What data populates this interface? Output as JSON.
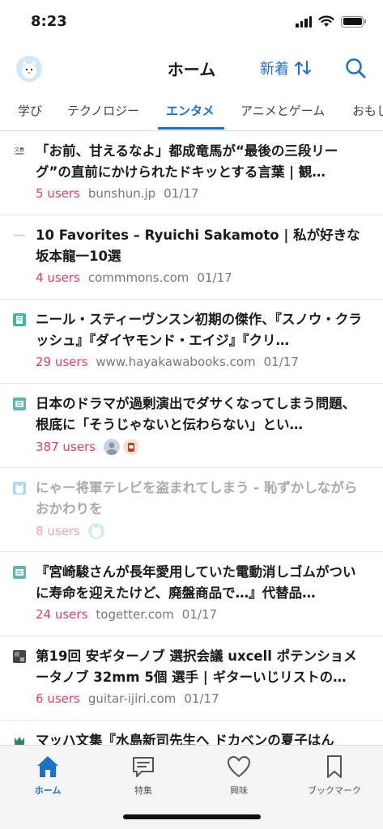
{
  "status": {
    "time": "8:23"
  },
  "header": {
    "title": "ホーム",
    "sort_label": "新着"
  },
  "tabs": [
    {
      "label": "学び"
    },
    {
      "label": "テクノロジー"
    },
    {
      "label": "エンタメ"
    },
    {
      "label": "アニメとゲーム"
    },
    {
      "label": "おもし"
    }
  ],
  "items": [
    {
      "title": "「お前、甘えるなよ」都成竜馬が“最後の三段リーグ”の直前にかけられたドキッとする言葉 | 観…",
      "users": "5 users",
      "domain": "bunshun.jp",
      "date": "01/17"
    },
    {
      "title": "10 Favorites – Ryuichi Sakamoto | 私が好きな坂本龍一10選",
      "users": "4 users",
      "domain": "commmons.com",
      "date": "01/17"
    },
    {
      "title": "ニール・スティーヴンスン初期の傑作、『スノウ・クラッシュ』『ダイヤモンド・エイジ』『クリ…",
      "users": "29 users",
      "domain": "www.hayakawabooks.com",
      "date": "01/17"
    },
    {
      "title": "日本のドラマが過剰演出でダサくなってしまう問題、根底に「そうじゃないと伝わらない」とい…",
      "users": "387 users",
      "domain": "",
      "date": ""
    },
    {
      "title": "にゃー将軍テレビを盗まれてしまう - 恥ずかしながら おかわりを",
      "users": "8 users",
      "domain": "",
      "date": ""
    },
    {
      "title": "『宮崎駿さんが長年愛用していた電動消しゴムがついに寿命を迎えたけど、廃盤商品で…』代替品…",
      "users": "24 users",
      "domain": "togetter.com",
      "date": "01/17"
    },
    {
      "title": "第19回 安ギターノブ 選択会議 uxcell ポテンショメータノブ 32mm 5個 選手 | ギターいじリストの…",
      "users": "6 users",
      "domain": "guitar-ijiri.com",
      "date": "01/17"
    },
    {
      "title": "マッハ文集『水島新司先生へ ドカベンの夏子はん",
      "users": "",
      "domain": "",
      "date": ""
    }
  ],
  "nav": [
    {
      "label": "ホーム",
      "icon": "home-icon"
    },
    {
      "label": "特集",
      "icon": "chat-icon"
    },
    {
      "label": "興味",
      "icon": "heart-icon"
    },
    {
      "label": "ブックマーク",
      "icon": "bookmark-icon"
    }
  ],
  "colors": {
    "accent": "#1a73c9",
    "users": "#e0406a"
  }
}
